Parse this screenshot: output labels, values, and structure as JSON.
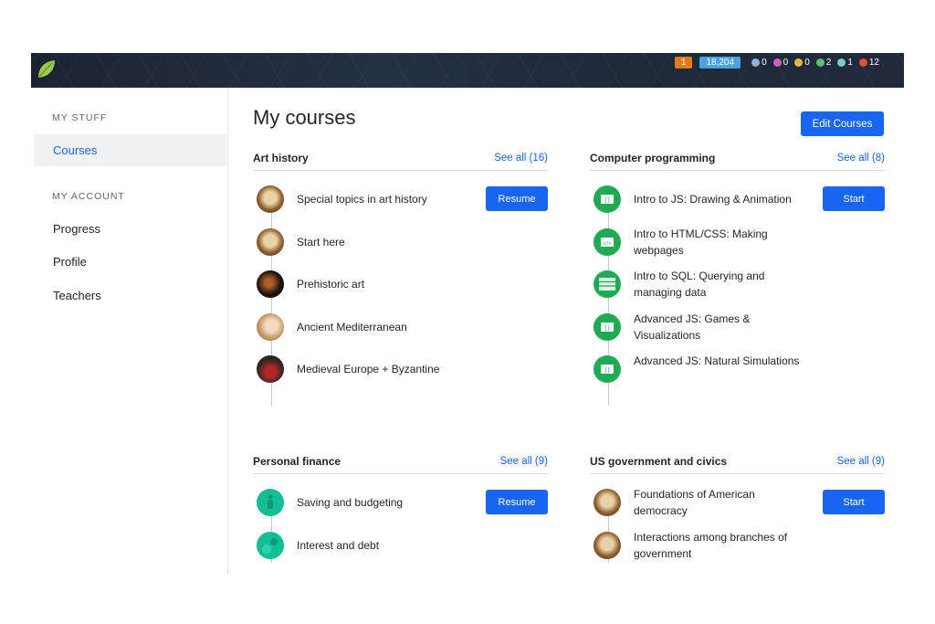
{
  "topbar": {
    "streak": "1",
    "points": "18,204",
    "medals": [
      {
        "icon": "meteorite-badge-icon",
        "count": "0",
        "color": "#8fb4d6"
      },
      {
        "icon": "moon-badge-icon",
        "count": "0",
        "color": "#d45ac6"
      },
      {
        "icon": "earth-badge-icon",
        "count": "0",
        "color": "#e6b93c"
      },
      {
        "icon": "sun-badge-icon",
        "count": "2",
        "color": "#5fbf6a"
      },
      {
        "icon": "black-hole-badge-icon",
        "count": "1",
        "color": "#7fc7d3"
      },
      {
        "icon": "challenge-patch-icon",
        "count": "12",
        "color": "#e0503a"
      }
    ]
  },
  "sidebar": {
    "my_stuff_heading": "MY STUFF",
    "courses": "Courses",
    "my_account_heading": "MY ACCOUNT",
    "progress": "Progress",
    "profile": "Profile",
    "teachers": "Teachers"
  },
  "main": {
    "title": "My courses",
    "edit_label": "Edit Courses"
  },
  "sections": {
    "art": {
      "title": "Art history",
      "see_all": "See all (16)",
      "action": "Resume",
      "items": [
        "Special topics in art history",
        "Start here",
        "Prehistoric art",
        "Ancient Mediterranean",
        "Medieval Europe + Byzantine"
      ]
    },
    "cs": {
      "title": "Computer programming",
      "see_all": "See all (8)",
      "action": "Start",
      "items": [
        "Intro to JS: Drawing & Animation",
        "Intro to HTML/CSS: Making webpages",
        "Intro to SQL: Querying and managing data",
        "Advanced JS: Games & Visualizations",
        "Advanced JS: Natural Simulations"
      ]
    },
    "finance": {
      "title": "Personal finance",
      "see_all": "See all (9)",
      "action": "Resume",
      "items": [
        "Saving and budgeting",
        "Interest and debt"
      ]
    },
    "gov": {
      "title": "US government and civics",
      "see_all": "See all (9)",
      "action": "Start",
      "items": [
        "Foundations of American democracy",
        "Interactions among branches of government"
      ]
    }
  },
  "colors": {
    "accent": "#1865f2",
    "cs_green": "#1fab54",
    "finance_teal": "#14bf96"
  }
}
